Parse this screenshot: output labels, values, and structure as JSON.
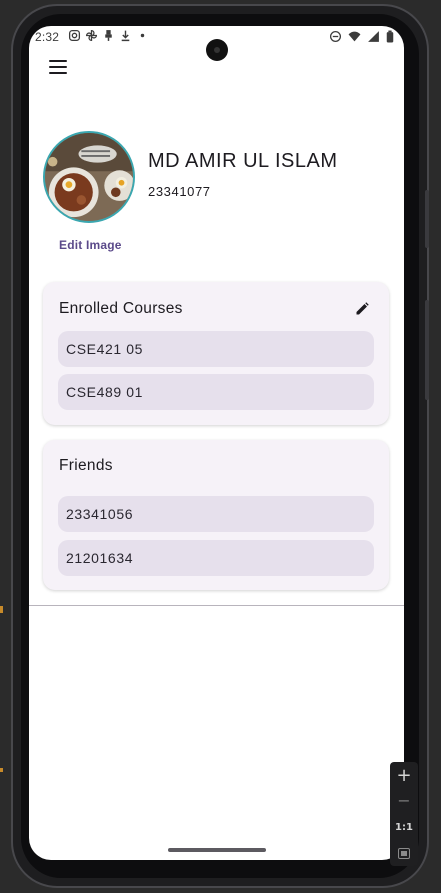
{
  "status_bar": {
    "time": "2:32",
    "left_icons": [
      "instagram-icon",
      "pinwheel-icon",
      "usb-icon",
      "download-icon",
      "dot-icon"
    ],
    "right_icons": [
      "dnd-icon",
      "wifi-icon",
      "signal-icon",
      "battery-icon"
    ]
  },
  "header": {
    "menu_icon": "hamburger-menu-icon"
  },
  "profile": {
    "name": "MD AMIR UL ISLAM",
    "student_id": "23341077",
    "edit_image_label": "Edit Image"
  },
  "enrolled_courses": {
    "title": "Enrolled Courses",
    "edit_icon": "pencil-icon",
    "items": [
      "CSE421 05",
      "CSE489 01"
    ]
  },
  "friends": {
    "title": "Friends",
    "items": [
      "23341056",
      "21201634"
    ]
  },
  "emulator_controls": {
    "zoom_in": "+",
    "zoom_out": "−",
    "actual_size": "1:1",
    "screenshot_icon": "frame-icon"
  },
  "colors": {
    "accent": "#5b4a8a",
    "card_bg": "#f6f2f8",
    "chip_bg": "#e6e0ec",
    "avatar_ring": "#3aa7b0"
  }
}
